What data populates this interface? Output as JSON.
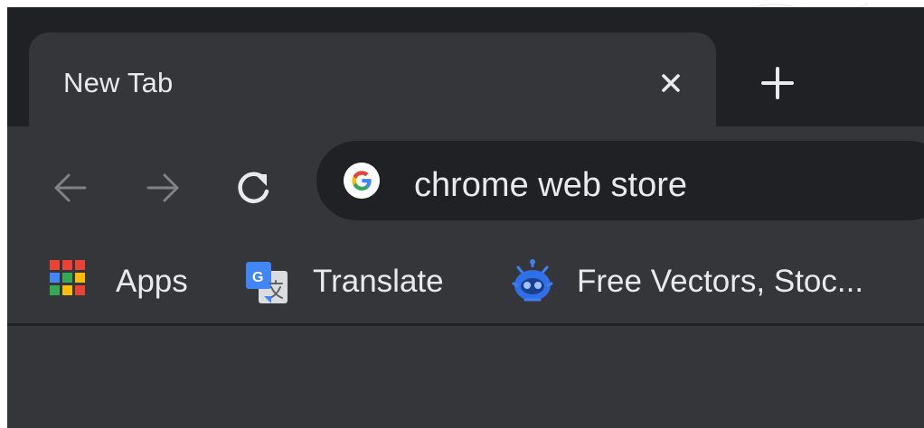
{
  "tab": {
    "title": "New Tab",
    "close_icon": "close-icon"
  },
  "toolbar": {
    "new_tab_icon": "plus-icon",
    "back_icon": "arrow-left-icon",
    "forward_icon": "arrow-right-icon",
    "reload_icon": "reload-icon"
  },
  "omnibox": {
    "value": "chrome web store",
    "search_engine_icon": "google-icon"
  },
  "bookmarks": {
    "items": [
      {
        "label": "Apps",
        "icon": "apps-grid-icon"
      },
      {
        "label": "Translate",
        "icon": "google-translate-icon"
      },
      {
        "label": "Free Vectors, Stoc...",
        "icon": "robot-icon"
      }
    ]
  },
  "colors": {
    "frame": "#202124",
    "toolbar": "#35363a",
    "text": "#e8eaed",
    "dim_icon": "#9aa0a6"
  }
}
